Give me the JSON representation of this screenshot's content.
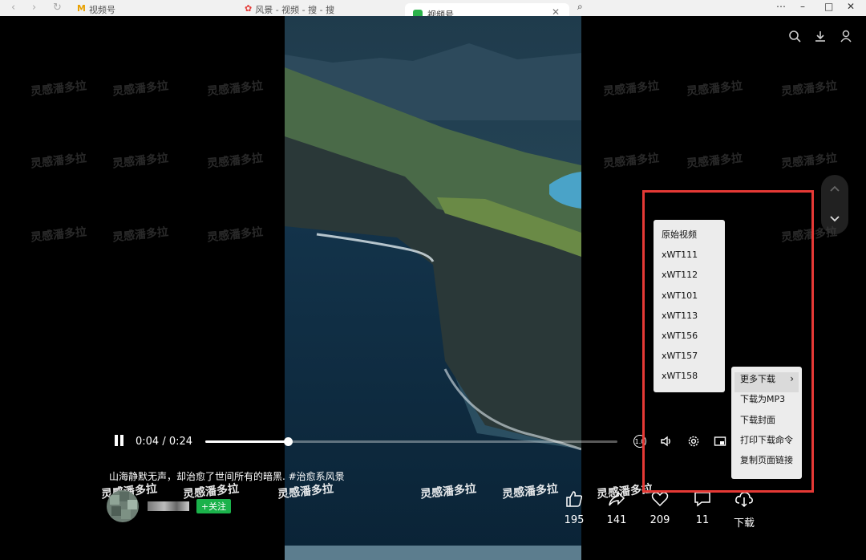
{
  "browser": {
    "tabs": [
      {
        "label": "视频号"
      },
      {
        "label": "风景 - 视频 - 搜 - 搜"
      }
    ],
    "active_tab": {
      "label": "视频号"
    }
  },
  "player": {
    "current_time": "0:04",
    "duration": "0:24",
    "time_display": "0:04 / 0:24",
    "progress_fraction": 0.2,
    "speed_label": "1.0"
  },
  "watermark_text": "灵感潘多拉",
  "caption": "山海静默无声，却治愈了世间所有的暗黑. #治愈系风景",
  "author": {
    "follow_label": "+关注"
  },
  "actions": {
    "like": {
      "count": "195"
    },
    "share": {
      "count": "141"
    },
    "favorite": {
      "count": "209"
    },
    "comment": {
      "count": "11"
    },
    "download": {
      "label": "下载"
    }
  },
  "quality_menu": {
    "items": [
      "原始视频",
      "xWT111",
      "xWT112",
      "xWT101",
      "xWT113",
      "xWT156",
      "xWT157",
      "xWT158"
    ]
  },
  "download_menu": {
    "items": [
      "更多下载",
      "下载为MP3",
      "下载封面",
      "打印下载命令",
      "复制页面链接"
    ]
  },
  "colors": {
    "follow_green": "#1bb24b",
    "highlight_red": "#e53935",
    "menu_bg": "#ececec"
  }
}
